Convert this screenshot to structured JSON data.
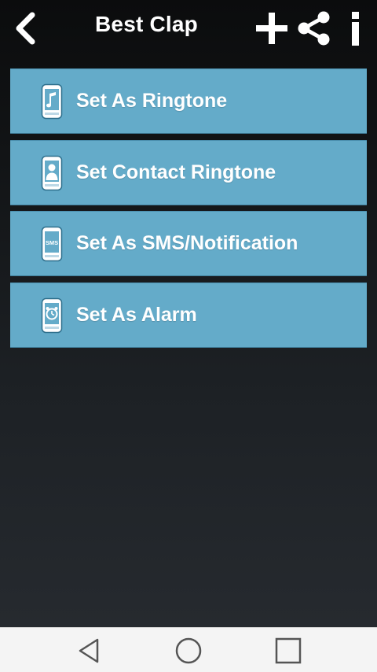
{
  "app_bar": {
    "title": "Best Clap",
    "icons": {
      "back": "back-arrow-icon",
      "add": "plus-icon",
      "share": "share-icon",
      "info": "info-icon"
    }
  },
  "menu": {
    "items": [
      {
        "label": "Set As Ringtone",
        "icon": "phone-music-note-icon"
      },
      {
        "label": "Set Contact Ringtone",
        "icon": "phone-contact-icon"
      },
      {
        "label": "Set As SMS/Notification",
        "icon": "phone-sms-icon",
        "icon_text": "SMS"
      },
      {
        "label": "Set As Alarm",
        "icon": "phone-alarm-clock-icon"
      }
    ]
  },
  "nav_bar": {
    "icons": [
      "nav-back-triangle-icon",
      "nav-home-circle-icon",
      "nav-recents-square-icon"
    ]
  },
  "colors": {
    "item_background": "#64abc9",
    "text": "#ffffff",
    "nav_background": "#f4f4f4",
    "nav_icon": "#555555"
  }
}
